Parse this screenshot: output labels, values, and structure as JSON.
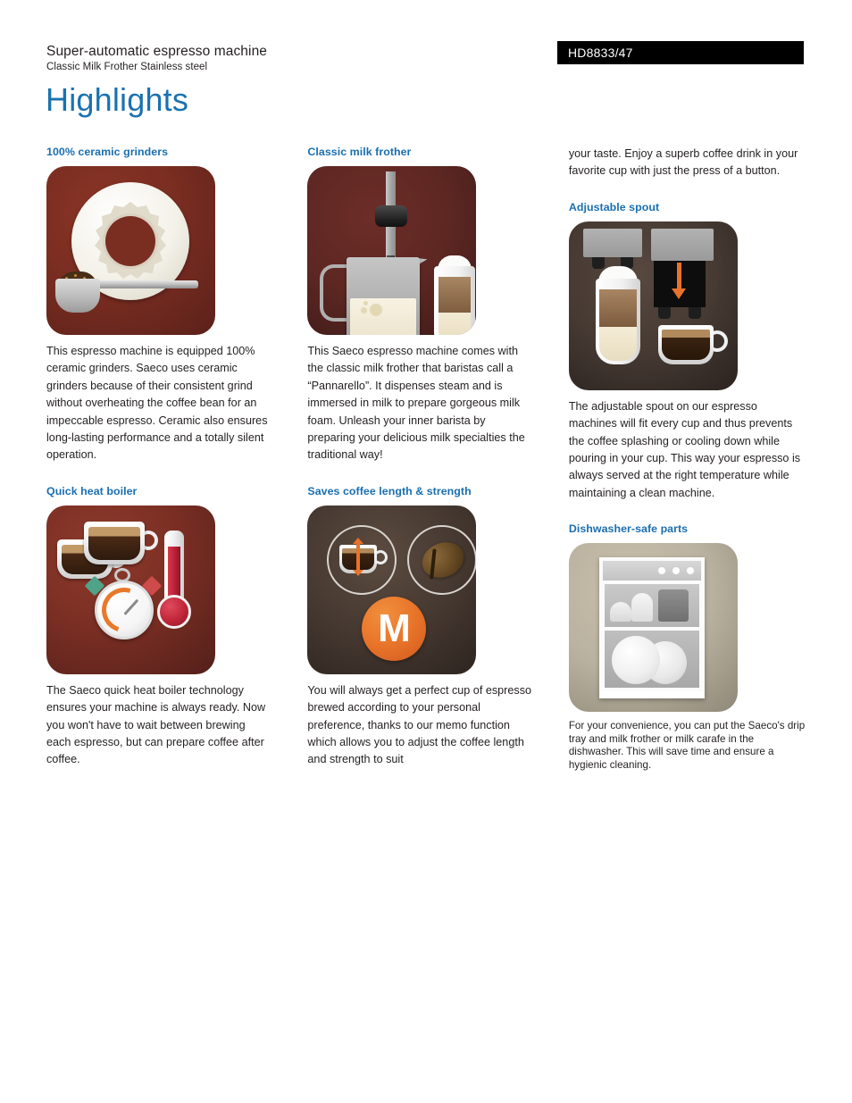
{
  "header": {
    "product_type": "Super-automatic espresso machine",
    "product_variant": "Classic Milk Frother Stainless steel",
    "sku": "HD8833/47",
    "page_heading": "Highlights"
  },
  "columns": [
    {
      "id": "column-1",
      "sections": [
        {
          "id": "ceramic-grinders",
          "title": "100% ceramic grinders",
          "image_alt": "ceramic-grinder-disc-illustration",
          "body": "This espresso machine is equipped 100% ceramic grinders. Saeco uses ceramic grinders because of their consistent grind without overheating the coffee bean for an impeccable espresso. Ceramic also ensures long-lasting performance and a totally silent operation."
        },
        {
          "id": "quick-heat-boiler",
          "title": "Quick heat boiler",
          "image_alt": "espresso-cups-stopwatch-thermometer-illustration",
          "body": "The Saeco quick heat boiler technology ensures your machine is always ready. Now you won't have to wait between brewing each espresso, but can prepare coffee after coffee."
        }
      ]
    },
    {
      "id": "column-2",
      "sections": [
        {
          "id": "classic-milk-frother",
          "title": "Classic milk frother",
          "image_alt": "milk-frother-wand-jug-latte-illustration",
          "body": "This Saeco espresso machine comes with the classic milk frother that baristas call a “Pannarello”. It dispenses steam and is immersed in milk to prepare gorgeous milk foam. Unleash your inner barista by preparing your delicious milk specialties the traditional way!"
        },
        {
          "id": "saves-coffee-length-strength",
          "title": "Saves coffee length & strength",
          "image_alt": "memo-function-cup-bean-m-button-illustration",
          "image_label": "M",
          "body": "You will always get a perfect cup of espresso brewed according to your personal preference, thanks to our memo function which allows you to adjust the coffee length and strength to suit"
        }
      ]
    },
    {
      "id": "column-3",
      "continuation": "your taste. Enjoy a superb coffee drink in your favorite cup with just the press of a button.",
      "sections": [
        {
          "id": "adjustable-spout",
          "title": "Adjustable spout",
          "image_alt": "adjustable-spout-latte-glass-espresso-cup-illustration",
          "body": "The adjustable spout on our espresso machines will fit every cup and thus prevents the coffee splashing or cooling down while pouring in your cup. This way your espresso is always served at the right temperature while maintaining a clean machine."
        },
        {
          "id": "dishwasher-safe-parts",
          "title": "Dishwasher-safe parts",
          "image_alt": "dishwasher-with-plates-and-cups-illustration",
          "body": "For your convenience, you can put the Saeco's drip tray and milk frother or milk carafe in the dishwasher. This will save time and ensure a hygienic cleaning."
        }
      ]
    }
  ],
  "colors": {
    "heading_blue": "#1a72b0",
    "section_title_blue": "#1a6fb0",
    "body_text": "#231f20",
    "sku_badge_bg": "#000000",
    "sku_badge_text": "#ffffff",
    "illustration_red": "#7a2e22",
    "illustration_maroon": "#5d2722",
    "illustration_dark_brown": "#463a33",
    "illustration_khaki": "#bab2a0",
    "accent_orange": "#e8742a"
  }
}
